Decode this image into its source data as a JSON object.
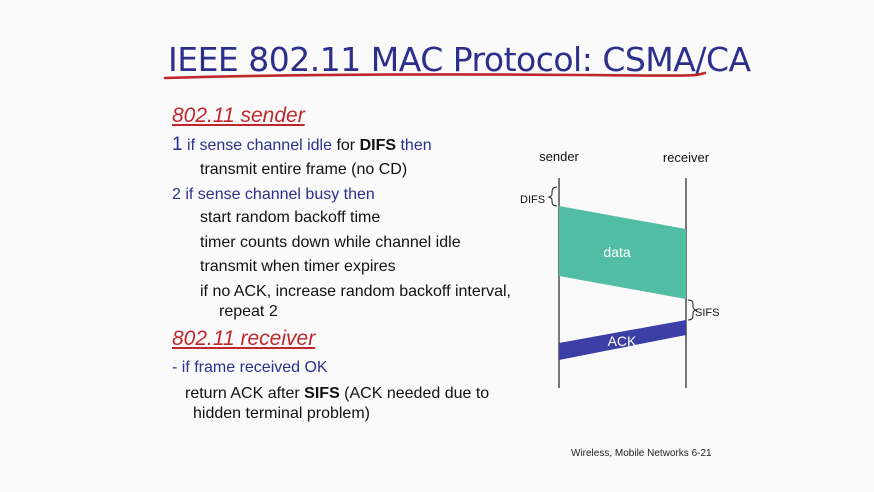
{
  "title": "IEEE 802.11 MAC Protocol: CSMA/CA",
  "sender": {
    "heading": "802.11 sender",
    "step1_num": "1",
    "step1_cond": " if sense channel idle",
    "step1_for": " for ",
    "step1_difs": "DIFS",
    "step1_then": "  then",
    "step1_action": "transmit entire frame (no CD)",
    "step2": "2 if sense channel busy then",
    "step2_items": [
      "start random backoff time",
      "timer counts down while channel idle",
      "transmit when timer expires",
      "if no ACK, increase random backoff interval,",
      "repeat 2"
    ]
  },
  "receiver": {
    "heading": "802.11 receiver",
    "cond": "- if frame received OK",
    "action_pre": "return ACK after ",
    "action_sifs": "SIFS",
    "action_post": " (ACK needed due to",
    "action_line2": "hidden terminal problem)"
  },
  "diagram": {
    "sender_label": "sender",
    "receiver_label": "receiver",
    "difs_label": "DIFS",
    "data_label": "data",
    "sifs_label": "SIFS",
    "ack_label": "ACK",
    "data_color": "#52bda5",
    "ack_color": "#3b3fa6"
  },
  "footer": "Wireless, Mobile Networks  6-21"
}
